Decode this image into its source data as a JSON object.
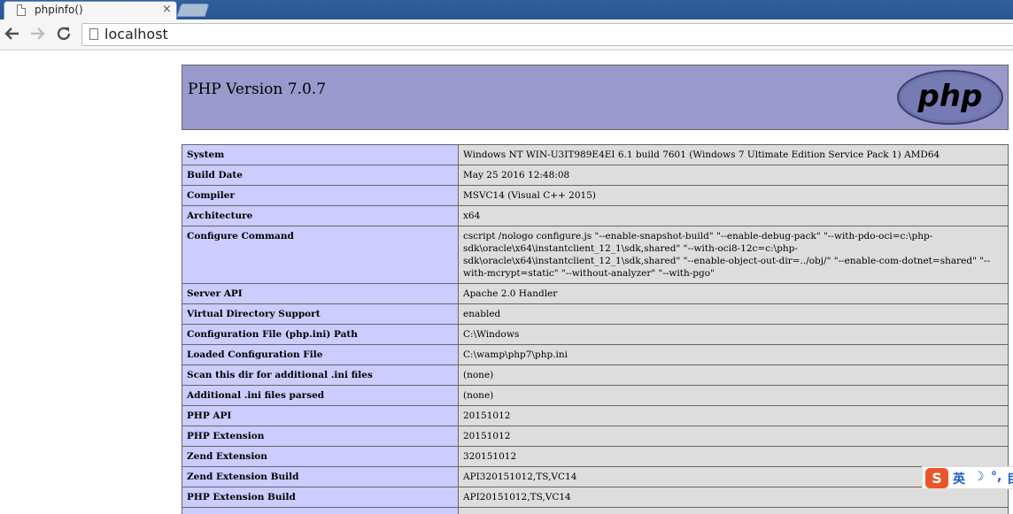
{
  "browser": {
    "tab_title": "phpinfo()",
    "tab_close_glyph": "×",
    "url": "localhost",
    "icons": {
      "back": "arrow-left-icon",
      "forward": "arrow-right-icon",
      "reload": "reload-icon",
      "page": "page-icon"
    }
  },
  "page": {
    "version_title": "PHP Version 7.0.7",
    "logo_text": "php",
    "colors": {
      "header_bg": "#9999cc",
      "key_cell_bg": "#ccccff",
      "value_cell_bg": "#dddddd"
    },
    "rows": [
      {
        "key": "System",
        "value": "Windows NT WIN-U3IT989E4EI 6.1 build 7601 (Windows 7 Ultimate Edition Service Pack 1) AMD64"
      },
      {
        "key": "Build Date",
        "value": "May 25 2016 12:48:08"
      },
      {
        "key": "Compiler",
        "value": "MSVC14 (Visual C++ 2015)"
      },
      {
        "key": "Architecture",
        "value": "x64"
      },
      {
        "key": "Configure Command",
        "value": "cscript /nologo configure.js \"--enable-snapshot-build\" \"--enable-debug-pack\" \"--with-pdo-oci=c:\\php-sdk\\oracle\\x64\\instantclient_12_1\\sdk,shared\" \"--with-oci8-12c=c:\\php-sdk\\oracle\\x64\\instantclient_12_1\\sdk,shared\" \"--enable-object-out-dir=../obj/\" \"--enable-com-dotnet=shared\" \"--with-mcrypt=static\" \"--without-analyzer\" \"--with-pgo\""
      },
      {
        "key": "Server API",
        "value": "Apache 2.0 Handler"
      },
      {
        "key": "Virtual Directory Support",
        "value": "enabled"
      },
      {
        "key": "Configuration File (php.ini) Path",
        "value": "C:\\Windows"
      },
      {
        "key": "Loaded Configuration File",
        "value": "C:\\wamp\\php7\\php.ini"
      },
      {
        "key": "Scan this dir for additional .ini files",
        "value": "(none)"
      },
      {
        "key": "Additional .ini files parsed",
        "value": "(none)"
      },
      {
        "key": "PHP API",
        "value": "20151012"
      },
      {
        "key": "PHP Extension",
        "value": "20151012"
      },
      {
        "key": "Zend Extension",
        "value": "320151012"
      },
      {
        "key": "Zend Extension Build",
        "value": "API320151012,TS,VC14"
      },
      {
        "key": "PHP Extension Build",
        "value": "API20151012,TS,VC14"
      },
      {
        "key": "",
        "value": ""
      }
    ]
  },
  "ime": {
    "logo": "S",
    "lang": "英",
    "moon": "☽",
    "punct": "°,",
    "more": "目"
  }
}
